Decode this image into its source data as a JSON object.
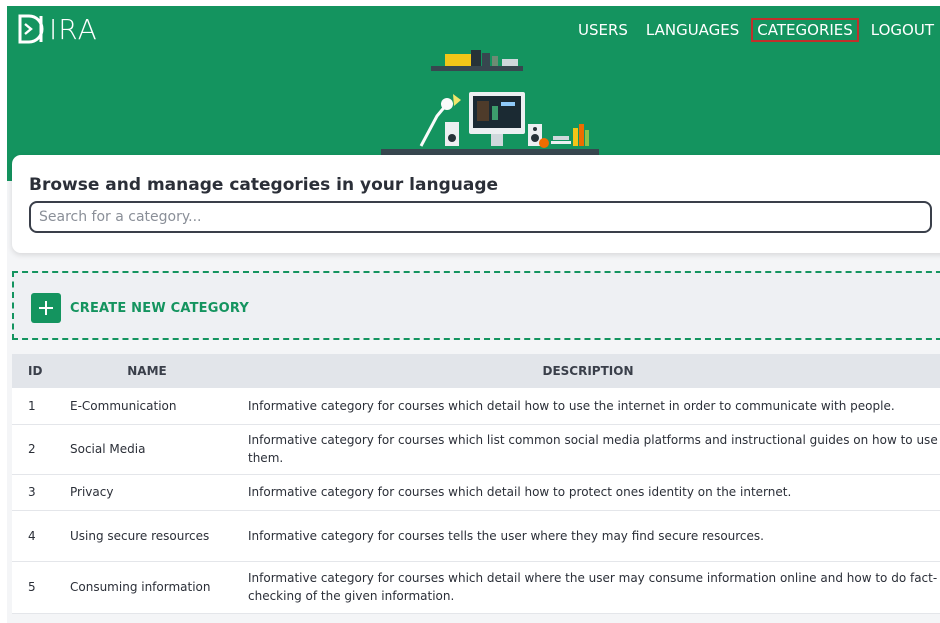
{
  "app": {
    "logo_text": "IRA"
  },
  "nav": {
    "items": [
      {
        "label": "USERS",
        "active": false
      },
      {
        "label": "LANGUAGES",
        "active": false
      },
      {
        "label": "CATEGORIES",
        "active": true
      },
      {
        "label": "LOGOUT",
        "active": false
      }
    ]
  },
  "search_card": {
    "title": "Browse and manage categories in your language",
    "placeholder": "Search for a category..."
  },
  "create": {
    "label": "CREATE NEW CATEGORY"
  },
  "table": {
    "headers": {
      "id": "ID",
      "name": "NAME",
      "description": "DESCRIPTION"
    },
    "rows": [
      {
        "id": "1",
        "name": "E-Communication",
        "description": "Informative category for courses which detail how to use the internet in order to communicate with people."
      },
      {
        "id": "2",
        "name": "Social Media",
        "description": "Informative category for courses which list common social media platforms and instructional guides on how to use them."
      },
      {
        "id": "3",
        "name": "Privacy",
        "description": "Informative category for courses which detail how to protect ones identity on the internet."
      },
      {
        "id": "4",
        "name": "Using secure resources",
        "description": "Informative category for courses tells the user where they may find secure resources."
      },
      {
        "id": "5",
        "name": "Consuming information",
        "description": "Informative category for courses which detail where the user may consume information online and how to do fact-checking of the given information."
      }
    ]
  },
  "colors": {
    "brand": "#14945f",
    "active_outline": "#c0302b",
    "text": "#2b2f38"
  }
}
